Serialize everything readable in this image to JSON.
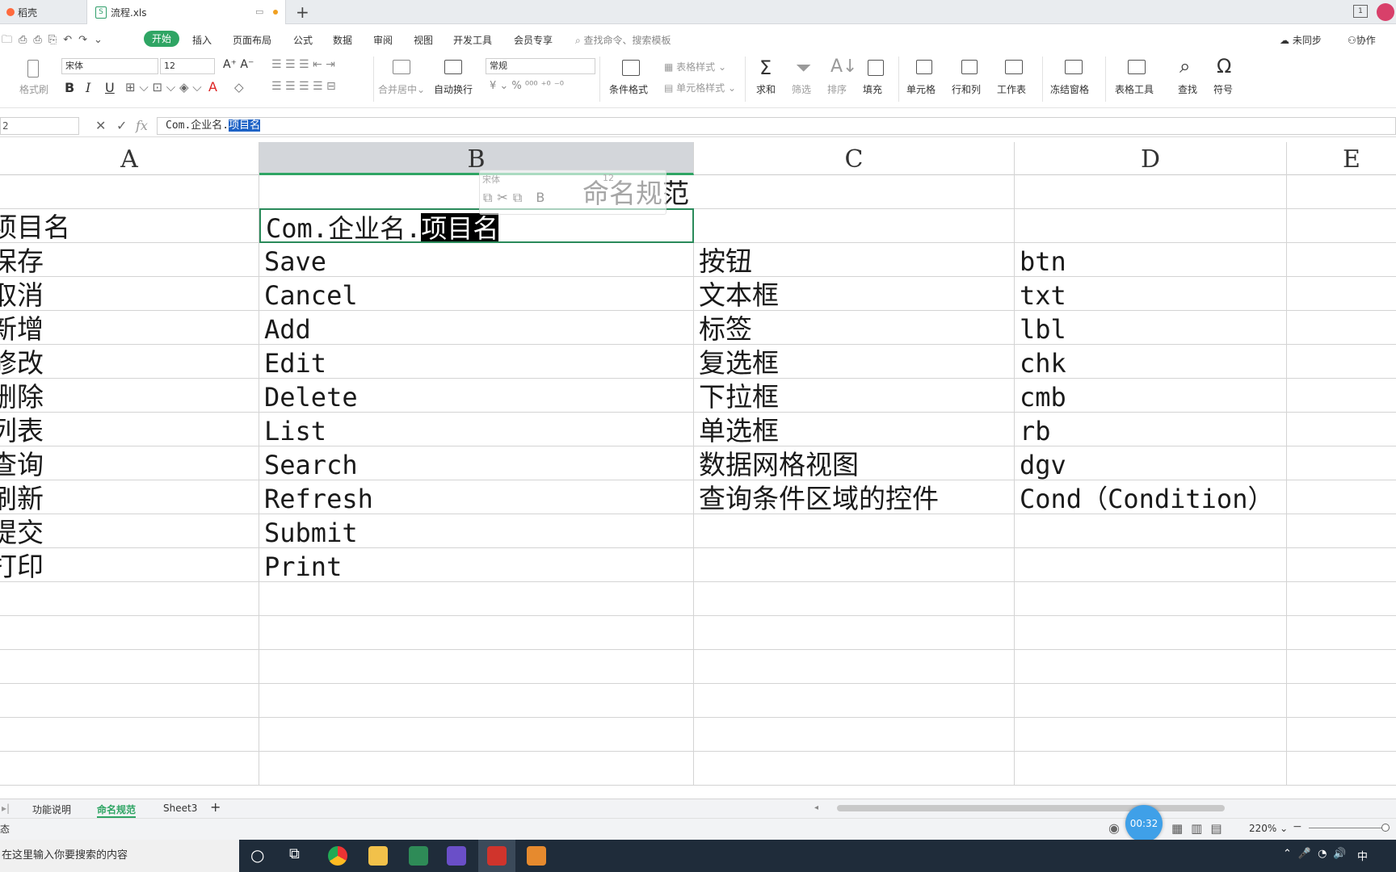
{
  "tabs": {
    "tab1": "稻壳",
    "tab2": "流程.xls"
  },
  "menu": {
    "start": "开始",
    "insert": "插入",
    "layout": "页面布局",
    "formula": "公式",
    "data": "数据",
    "review": "审阅",
    "view": "视图",
    "dev": "开发工具",
    "vip": "会员专享",
    "search": "查找命令、搜索模板",
    "sync": "未同步",
    "collab": "协作"
  },
  "ribbon": {
    "font_name": "宋体",
    "font_size": "12",
    "format_painter": "格式刷",
    "number_format": "常规",
    "merge": "合并居中",
    "wrap": "自动换行",
    "cond_format": "条件格式",
    "table_style": "表格样式",
    "cell_style": "单元格样式",
    "sum": "求和",
    "filter": "筛选",
    "sort": "排序",
    "fill": "填充",
    "cell": "单元格",
    "rowcol": "行和列",
    "sheet": "工作表",
    "freeze": "冻结窗格",
    "table_tools": "表格工具",
    "find": "查找",
    "symbol": "符号"
  },
  "formula_bar": {
    "name_box": "2",
    "fx": "fx",
    "value_prefix": "Com.企业名.",
    "value_selected": "项目名"
  },
  "columns": [
    "A",
    "B",
    "C",
    "D",
    "E"
  ],
  "title_cell": "命名规范",
  "rows": [
    {
      "a": "项目名",
      "b_prefix": "Com.企业名.",
      "b_sel": "项目名",
      "c": "",
      "d": ""
    },
    {
      "a": "保存",
      "b": "Save",
      "c": "按钮",
      "d": "btn"
    },
    {
      "a": "取消",
      "b": "Cancel",
      "c": "文本框",
      "d": "txt"
    },
    {
      "a": "新增",
      "b": "Add",
      "c": "标签",
      "d": "lbl"
    },
    {
      "a": "修改",
      "b": "Edit",
      "c": "复选框",
      "d": "chk"
    },
    {
      "a": "删除",
      "b": "Delete",
      "c": "下拉框",
      "d": "cmb"
    },
    {
      "a": "列表",
      "b": "List",
      "c": "单选框",
      "d": "rb"
    },
    {
      "a": "查询",
      "b": "Search",
      "c": "数据网格视图",
      "d": "dgv"
    },
    {
      "a": "刷新",
      "b": "Refresh",
      "c": "查询条件区域的控件",
      "d": "Cond（Condition）"
    },
    {
      "a": "提交",
      "b": "Submit",
      "c": "",
      "d": ""
    },
    {
      "a": "打印",
      "b": "Print",
      "c": "",
      "d": ""
    }
  ],
  "mini_toolbar": {
    "font": "宋体",
    "size": "12"
  },
  "sheet_tabs": [
    "功能说明",
    "命名规范",
    "Sheet3"
  ],
  "status": {
    "left": "态",
    "timer": "00:32",
    "zoom": "220%"
  },
  "taskbar": {
    "search": "在这里输入你要搜索的内容",
    "ime": "中"
  },
  "colors": {
    "accent_green": "#2fa564",
    "selection_blue": "#1e63c6",
    "taskbar": "#1f2c3a"
  }
}
